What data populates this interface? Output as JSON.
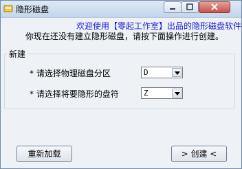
{
  "window": {
    "title": "隐形磁盘"
  },
  "header": {
    "welcome": "欢迎使用【零起工作室】出品的隐形磁盘软件！",
    "info": "你现在还没有建立隐形磁盘，请按下面操作进行创建。"
  },
  "group": {
    "title": "新建",
    "rows": [
      {
        "label": "* 请选择物理磁盘分区",
        "value": "D"
      },
      {
        "label": "* 请选择将要隐形的盘符",
        "value": "Z"
      }
    ]
  },
  "buttons": {
    "reload": "重新加载",
    "create": "> 创建 <"
  },
  "colors": {
    "accent_text": "#1a1ad8"
  }
}
